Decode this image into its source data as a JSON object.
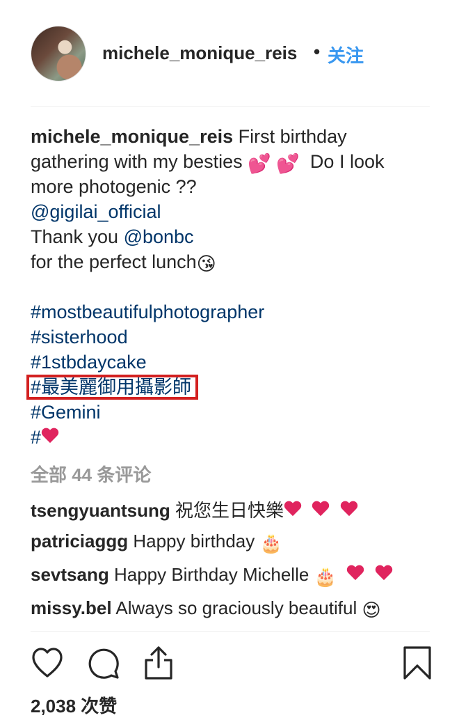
{
  "header": {
    "username": "michele_monique_reis",
    "separator": "•",
    "follow_label": "关注"
  },
  "caption": {
    "author": "michele_monique_reis",
    "line1_text": " First birthday",
    "line2_text": "gathering with my besties ",
    "line2_emoji1": "💕",
    "line2_emoji2": "💕",
    "line2_text_end": "  Do I look",
    "line3_text": "more photogenic ??",
    "mention1": "@gigilai_official",
    "line5_text": "Thank you ",
    "mention2": "@bonbc",
    "line6_text": "for the perfect lunch",
    "line6_emoji": "😘",
    "hashtags": [
      "#mostbeautifulphotographer",
      "#sisterhood",
      "#1stbdaycake",
      "#最美麗御用攝影師",
      "#Gemini",
      "#"
    ]
  },
  "view_all_comments": "全部 44 条评论",
  "comments": [
    {
      "author": "tsengyuantsung",
      "text": " 祝您生日快樂",
      "hearts": 3,
      "emoji": ""
    },
    {
      "author": "patriciaggg",
      "text": " Happy birthday ",
      "hearts": 0,
      "emoji": "🎂"
    },
    {
      "author": "sevtsang",
      "text": " Happy Birthday Michelle ",
      "hearts": 2,
      "emoji": "🎂"
    },
    {
      "author": "missy.bel",
      "text": " Always so graciously beautiful ",
      "hearts": 0,
      "emoji": "😍"
    }
  ],
  "likes_text": "2,038 次赞",
  "icons": {
    "like": "heart-outline-icon",
    "comment": "speech-bubble-icon",
    "share": "share-upload-icon",
    "save": "bookmark-icon"
  },
  "colors": {
    "link": "#003569",
    "follow": "#3897f0",
    "highlight_box": "#d32020",
    "heart": "#e0245e"
  }
}
